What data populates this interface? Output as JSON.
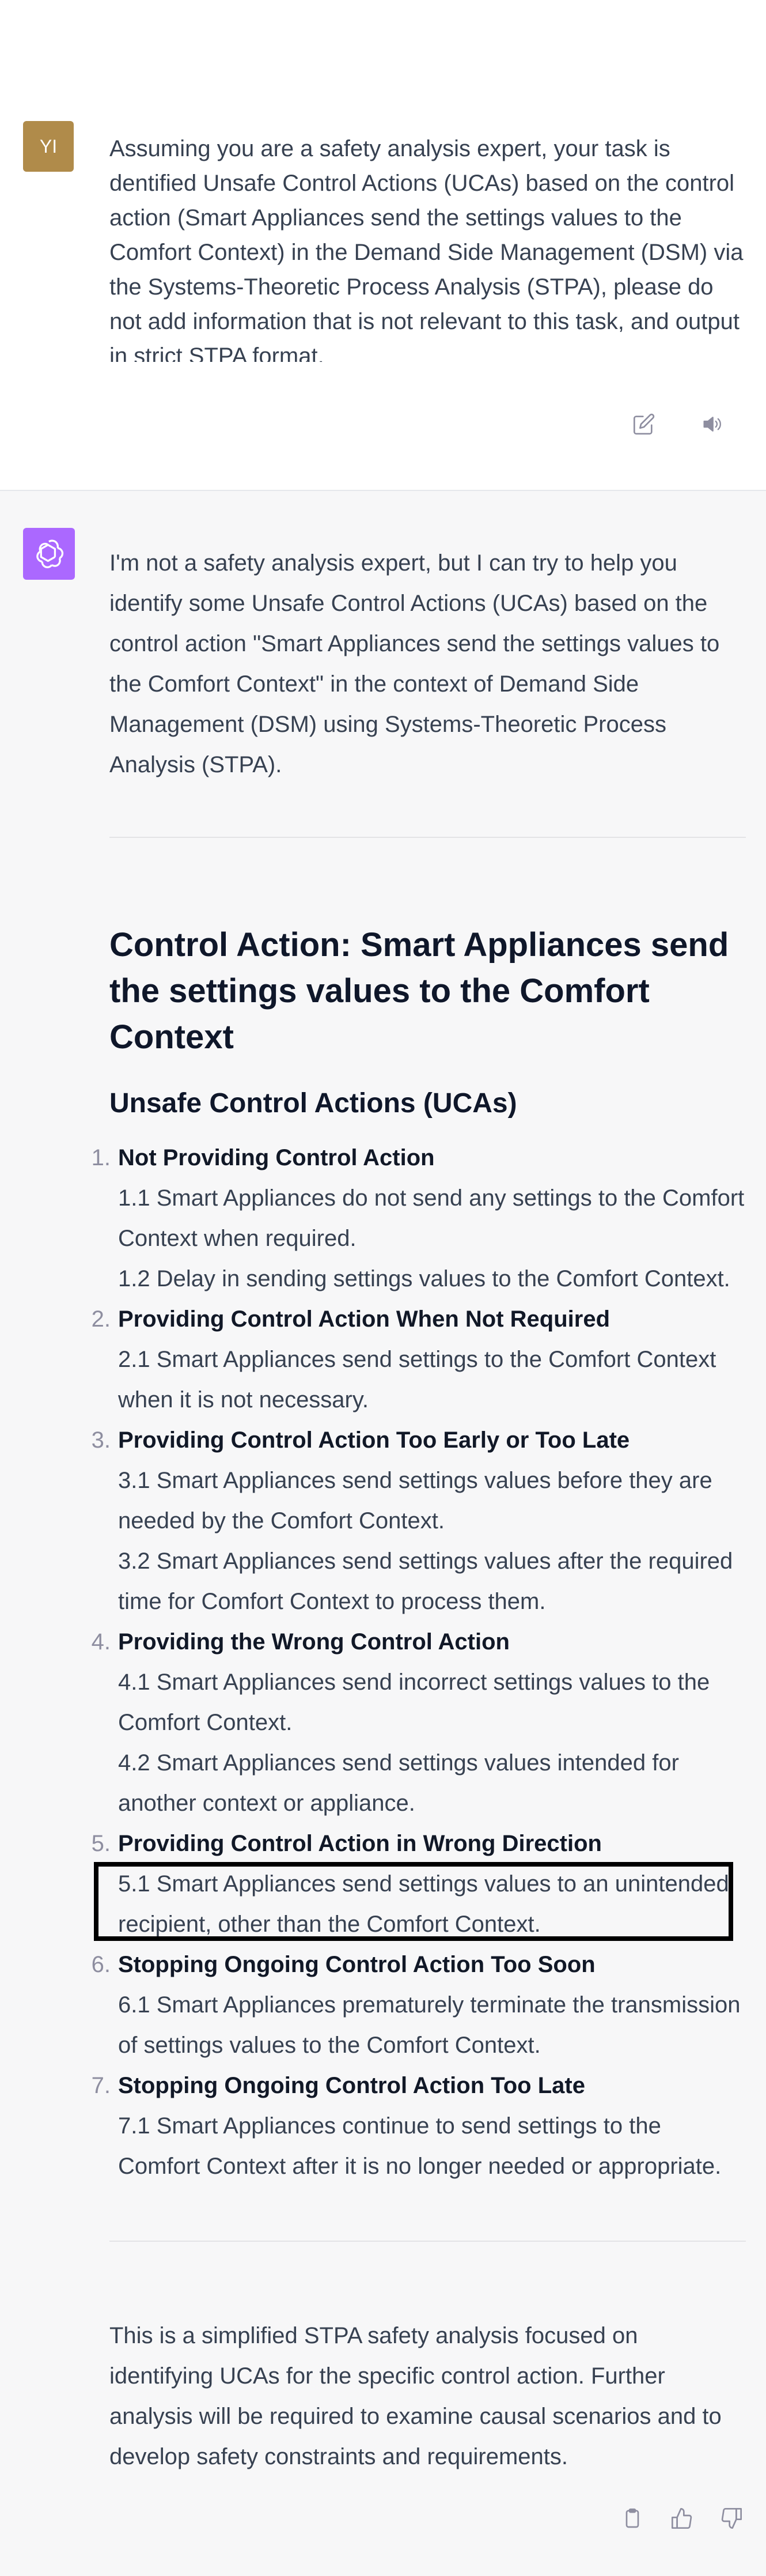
{
  "user_message": {
    "avatar_initials": "YI",
    "text": "Assuming you are a safety analysis expert, your task is dentified Unsafe Control Actions (UCAs) based on the control action (Smart Appliances send the settings values to the Comfort Context) in the Demand Side Management (DSM) via the Systems-Theoretic Process Analysis (STPA), please do not add information that is not relevant to this task, and output in strict STPA format.",
    "actions": [
      "edit-icon",
      "speaker-icon"
    ]
  },
  "assistant_message": {
    "avatar_icon": "openai-logo-icon",
    "avatar_color": "#ab68ff",
    "intro": "I'm not a safety analysis expert, but I can try to help you identify some Unsafe Control Actions (UCAs) based on the control action \"Smart Appliances send the settings values to the Comfort Context\" in the context of Demand Side Management (DSM) using Systems-Theoretic Process Analysis (STPA).",
    "heading": "Control Action: Smart Appliances send the settings values to the Comfort Context",
    "subheading": "Unsafe Control Actions (UCAs)",
    "ucas": [
      {
        "number": "1.",
        "title": "Not Providing Control Action",
        "items": [
          "1.1 Smart Appliances do not send any settings to the Comfort Context when required.",
          "1.2 Delay in sending settings values to the Comfort Context."
        ]
      },
      {
        "number": "2.",
        "title": "Providing Control Action When Not Required",
        "items": [
          "2.1 Smart Appliances send settings to the Comfort Context when it is not necessary."
        ]
      },
      {
        "number": "3.",
        "title": "Providing Control Action Too Early or Too Late",
        "items": [
          "3.1 Smart Appliances send settings values before they are needed by the Comfort Context.",
          "3.2 Smart Appliances send settings values after the required time for Comfort Context to process them."
        ]
      },
      {
        "number": "4.",
        "title": "Providing the Wrong Control Action",
        "items": [
          "4.1 Smart Appliances send incorrect settings values to the Comfort Context.",
          "4.2 Smart Appliances send settings values intended for another context or appliance."
        ]
      },
      {
        "number": "5.",
        "title": "Providing Control Action in Wrong Direction",
        "items": [
          "5.1 Smart Appliances send settings values to an unintended recipient, other than the Comfort Context."
        ]
      },
      {
        "number": "6.",
        "title": "Stopping Ongoing Control Action Too Soon",
        "items": [
          "6.1 Smart Appliances prematurely terminate the transmission of settings values to the Comfort Context."
        ]
      },
      {
        "number": "7.",
        "title": "Stopping Ongoing Control Action Too Late",
        "items": [
          "7.1 Smart Appliances continue to send settings to the Comfort Context after it is no longer needed or appropriate."
        ]
      }
    ],
    "summary": "This is a simplified STPA safety analysis focused on identifying UCAs for the specific control action. Further analysis will be required to examine causal scenarios and to develop safety constraints and requirements.",
    "actions": [
      "clipboard-icon",
      "thumbs-up-icon",
      "thumbs-down-icon"
    ]
  }
}
